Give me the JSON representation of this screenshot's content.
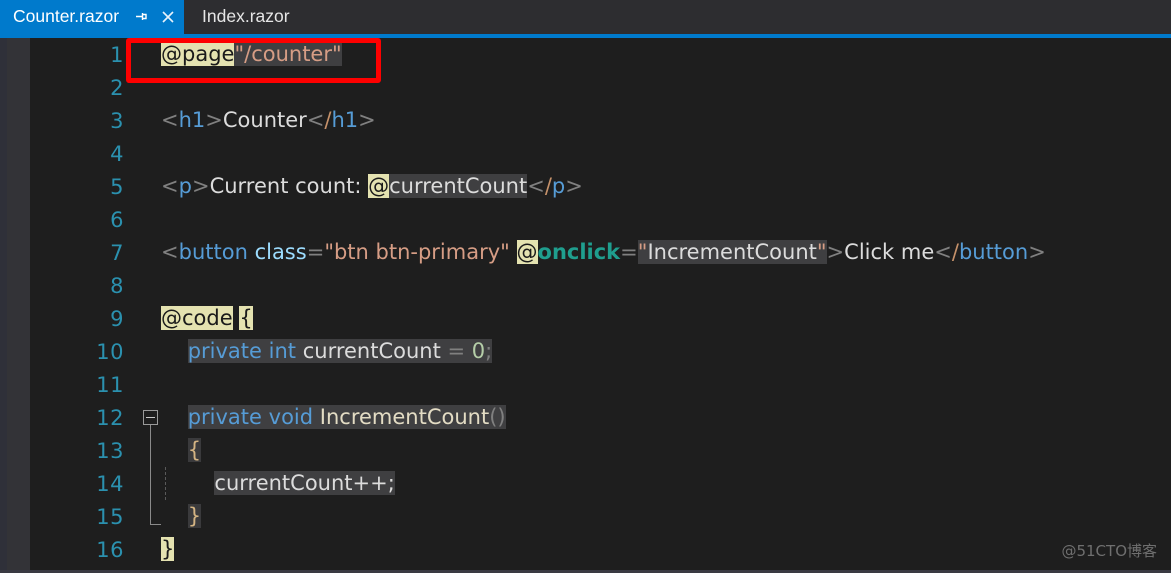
{
  "window": {
    "app": "Visual Studio Code Editor",
    "accent_color": "#007acc",
    "editor_bg": "#1e1e1e"
  },
  "tabs": [
    {
      "label": "Counter.razor",
      "active": true,
      "pin_icon": "pin-icon",
      "close_icon": "close-icon"
    },
    {
      "label": "Index.razor",
      "active": false
    }
  ],
  "annotation": {
    "color": "#fe0000",
    "target_line": 1
  },
  "watermark": {
    "text": "@51CTO博客"
  },
  "gutter": {
    "line_numbers": [
      "1",
      "2",
      "3",
      "4",
      "5",
      "6",
      "7",
      "8",
      "9",
      "10",
      "11",
      "12",
      "13",
      "14",
      "15",
      "16"
    ]
  },
  "code": {
    "language": "razor",
    "file": "Counter.razor",
    "lines": [
      {
        "n": "1",
        "text": "@page \"/counter\""
      },
      {
        "n": "2",
        "text": ""
      },
      {
        "n": "3",
        "text": "<h1>Counter</h1>"
      },
      {
        "n": "4",
        "text": ""
      },
      {
        "n": "5",
        "text": "<p>Current count: @currentCount</p>"
      },
      {
        "n": "6",
        "text": ""
      },
      {
        "n": "7",
        "text": "<button class=\"btn btn-primary\" @onclick=\"IncrementCount\">Click me</button>"
      },
      {
        "n": "8",
        "text": ""
      },
      {
        "n": "9",
        "text": "@code {"
      },
      {
        "n": "10",
        "text": "    private int currentCount = 0;"
      },
      {
        "n": "11",
        "text": ""
      },
      {
        "n": "12",
        "text": "    private void IncrementCount()"
      },
      {
        "n": "13",
        "text": "    {"
      },
      {
        "n": "14",
        "text": "        currentCount++;"
      },
      {
        "n": "15",
        "text": "    }"
      },
      {
        "n": "16",
        "text": "}"
      }
    ],
    "tokens": {
      "page_directive": "@page",
      "route": "\"/counter\"",
      "h1_open_lt": "<",
      "h1_open_name": "h1",
      "h1_open_gt": ">",
      "h1_content": "Counter",
      "h1_close_lt": "<",
      "h1_close_slash": "/",
      "h1_close_name": "h1",
      "h1_close_gt": ">",
      "p_open_lt": "<",
      "p_open_name": "p",
      "p_open_gt": ">",
      "p_content": "Current count: ",
      "p_at": "@",
      "p_expr": "currentCount",
      "p_close_lt": "<",
      "p_close_slash": "/",
      "p_close_name": "p",
      "p_close_gt": ">",
      "btn_lt": "<",
      "btn_name": "button",
      "btn_space": " ",
      "btn_attr_class": "class",
      "btn_eq1": "=",
      "btn_class_value": "\"btn btn-primary\"",
      "btn_space2": " ",
      "btn_at": "@",
      "btn_onclick": "onclick",
      "btn_eq2": "=",
      "btn_quote_open": "\"",
      "btn_handler": "IncrementCount",
      "btn_quote_close": "\"",
      "btn_gt": ">",
      "btn_label": "Click me",
      "btn_close_lt": "<",
      "btn_close_slash": "/",
      "btn_close_name": "button",
      "btn_close_gt": ">",
      "code_directive": "@code",
      "code_space": " ",
      "code_brace_open": "{",
      "kw_private": "private",
      "kw_int": "int",
      "field_name": "currentCount",
      "assign": " = ",
      "zero": "0",
      "semi": ";",
      "kw_void": "void",
      "method_name": "IncrementCount",
      "method_parens": "()",
      "body_brace_open": "{",
      "incr_expr": "currentCount++;",
      "body_brace_close": "}",
      "code_brace_close": "}"
    }
  }
}
